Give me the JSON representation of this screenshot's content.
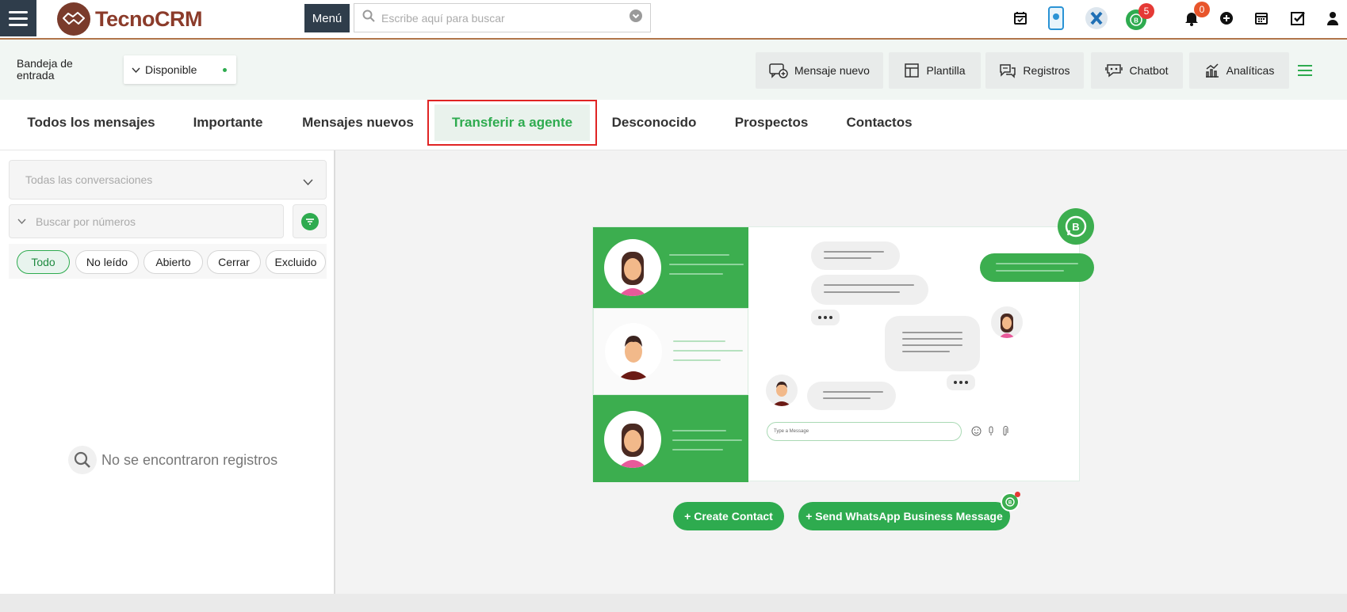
{
  "brand": {
    "name": "TecnoCRM"
  },
  "topbar": {
    "menu_label": "Menú",
    "search_placeholder": "Escribe aquí para buscar",
    "whatsapp_badge": "5",
    "notifications_badge": "0"
  },
  "header": {
    "inbox_title": "Bandeja de entrada",
    "status_value": "Disponible",
    "buttons": {
      "new_message": "Mensaje nuevo",
      "template": "Plantilla",
      "records": "Registros",
      "chatbot": "Chatbot",
      "analytics": "Analíticas"
    }
  },
  "tabs": [
    {
      "label": "Todos los mensajes"
    },
    {
      "label": "Importante"
    },
    {
      "label": "Mensajes nuevos"
    },
    {
      "label": "Transferir a agente"
    },
    {
      "label": "Desconocido"
    },
    {
      "label": "Prospectos"
    },
    {
      "label": "Contactos"
    }
  ],
  "active_tab": "Transferir a agente",
  "left_panel": {
    "conversation_filter": "Todas las conversaciones",
    "number_search_placeholder": "Buscar por números",
    "pills": [
      "Todo",
      "No leído",
      "Abierto",
      "Cerrar",
      "Excluido"
    ],
    "active_pill": "Todo",
    "empty_message": "No se encontraron registros"
  },
  "illustration": {
    "typing_placeholder": "Type a Message"
  },
  "actions": {
    "create_contact": "+ Create Contact",
    "send_whatsapp": "+ Send WhatsApp Business Message"
  },
  "colors": {
    "accent_green": "#2eab4f",
    "nav_dark": "#2f3d4b",
    "brand_brown": "#8b3b2a",
    "highlight_red": "#e02424",
    "badge_red": "#e53935"
  }
}
